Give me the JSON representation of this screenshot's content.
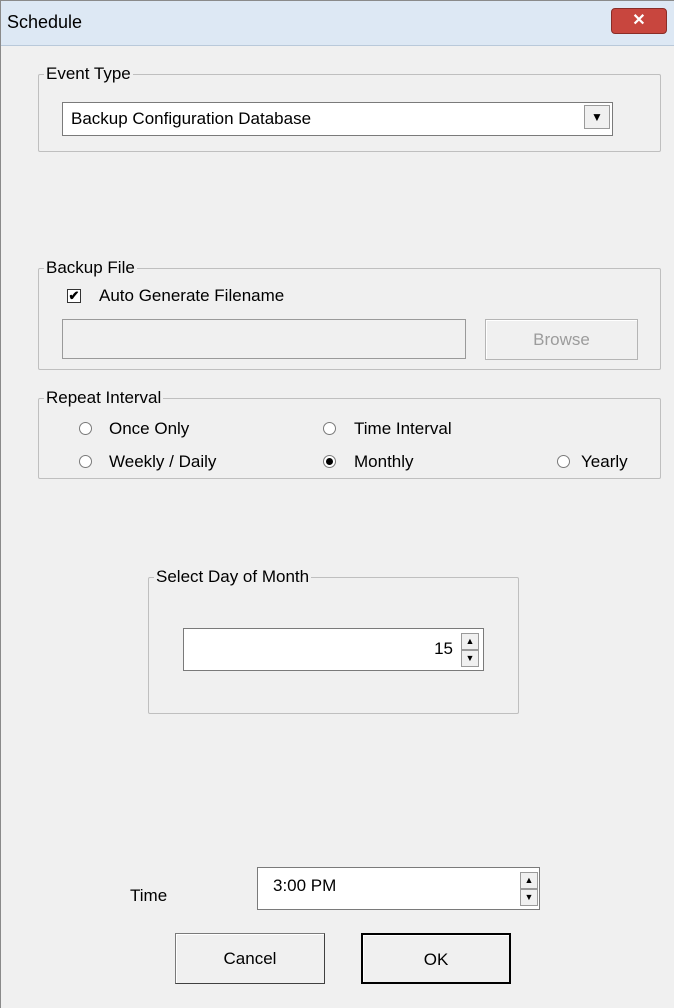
{
  "window": {
    "title": "Schedule",
    "close_label": "✕"
  },
  "event_type": {
    "legend": "Event Type",
    "selected": "Backup Configuration Database",
    "dropdown_glyph": "▼"
  },
  "backup_file": {
    "legend": "Backup File",
    "auto_generate_label": "Auto Generate Filename",
    "auto_generate_checked": true,
    "check_glyph": "✔",
    "filename_value": "",
    "browse_label": "Browse"
  },
  "repeat_interval": {
    "legend": "Repeat Interval",
    "options": [
      {
        "label": "Once Only",
        "selected": false
      },
      {
        "label": "Time Interval",
        "selected": false
      },
      {
        "label": "Weekly / Daily",
        "selected": false
      },
      {
        "label": "Monthly",
        "selected": true
      },
      {
        "label": "Yearly",
        "selected": false
      }
    ]
  },
  "day_of_month": {
    "legend": "Select Day of Month",
    "value": "15",
    "up_glyph": "▲",
    "down_glyph": "▼"
  },
  "time": {
    "label": "Time",
    "value": "3:00 PM",
    "up_glyph": "▲",
    "down_glyph": "▼"
  },
  "buttons": {
    "cancel_label": "Cancel",
    "ok_label": "OK"
  }
}
